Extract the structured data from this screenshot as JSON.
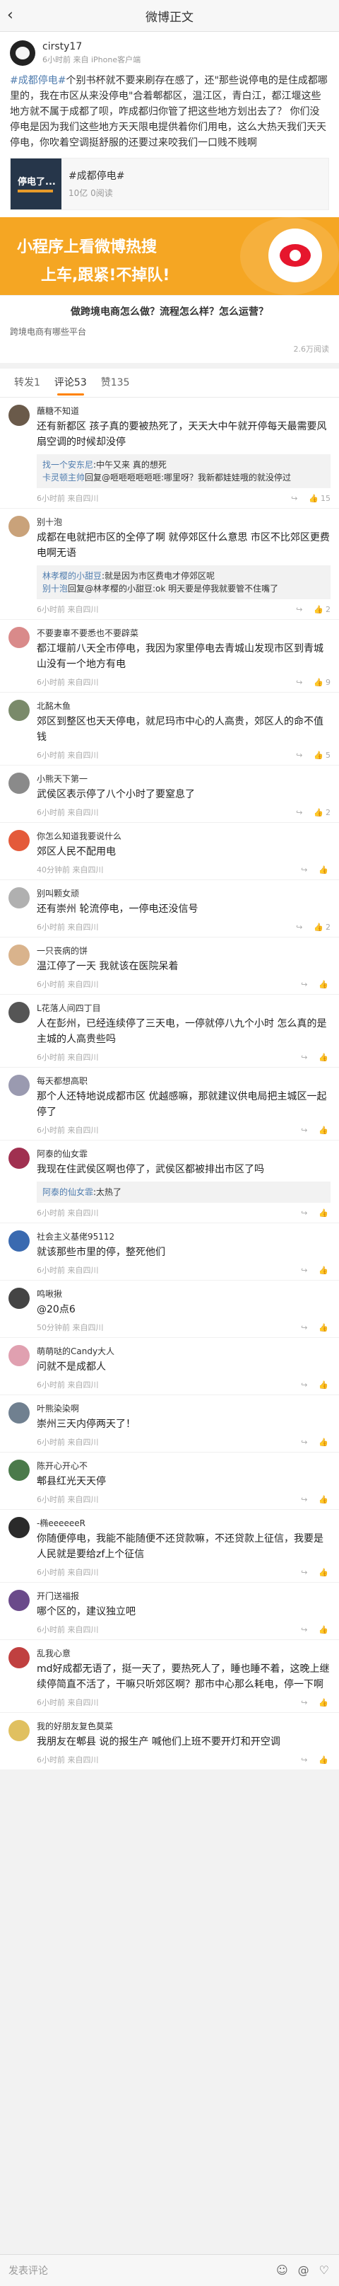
{
  "topbar": {
    "back_icon": "back-arrow",
    "title": "微博正文"
  },
  "post": {
    "author": "cirsty17",
    "meta": "6小时前 来自 iPhone客户端",
    "hashtag": "#成都停电#",
    "text": "个别书杯就不要来刷存在感了，还\"那些说停电的是住成都哪里的，我在市区从来没停电\"合着郫都区，温江区，青白江，都江堰这些地方就不属于成都了呗，咋成都归你管了把这些地方划出去了？ 你们没停电是因为我们这些地方天天限电提供着你们用电，这么大热天我们天天停电，你吹着空调挺舒服的还要过来咬我们一口贱不贱啊",
    "share": {
      "thumb_text": "停电了...",
      "title": "#成都停电#",
      "reads": "10亿 0阅读"
    }
  },
  "banner": {
    "line1": "小程序上看微博热搜",
    "line2": "上车,跟紧!不掉队!"
  },
  "ad": {
    "title": "做跨境电商怎么做？流程怎么样？怎么运营？",
    "sub": "跨境电商有哪些平台",
    "reads": "2.6万阅读"
  },
  "tabs": {
    "repost": "转发1",
    "comment": "评论53",
    "like": "赞135"
  },
  "comments": [
    {
      "name": "蘸糖不知道",
      "text": "还有新都区 孩子真的要被热死了，天天大中午就开停每天最需要风扇空调的时候却没停",
      "reply": [
        {
          "n": "找一个安东尼",
          "t": ":中午又来 真的想死"
        },
        {
          "n": "卡灵顿主帅",
          "t": "回复@咂咂咂咂咂咂:哪里呀？我新都娃娃哦的就没停过"
        }
      ],
      "time": "6小时前 来自四川",
      "likes": "15",
      "avatar": "#6a5a4a"
    },
    {
      "name": "别十泡",
      "text": "成都在电就把市区的全停了啊 就停郊区什么意思 市区不比郊区更费电啊无语",
      "reply": [
        {
          "n": "林孝樱的小甜豆",
          "t": ":就是因为市区费电才停郊区呢"
        },
        {
          "n": "别十泡",
          "t": "回复@林孝樱的小甜豆:ok 明天要是停我就要管不住嘴了"
        }
      ],
      "time": "6小时前 来自四川",
      "likes": "2",
      "avatar": "#c9a27a"
    },
    {
      "name": "不要妻辜不要悉也不要辟菜",
      "text": "都江堰前八天全市停电，我因为家里停电去青城山发现市区到青城山没有一个地方有电",
      "reply": [],
      "time": "6小时前 来自四川",
      "likes": "9",
      "avatar": "#d98a8a"
    },
    {
      "name": "北酩木鱼",
      "text": "郊区到整区也天天停电，就尼玛市中心的人高贵，郊区人的命不值钱",
      "reply": [],
      "time": "6小时前 来自四川",
      "likes": "5",
      "avatar": "#7a8a6a"
    },
    {
      "name": "小熊天下第一",
      "text": "武侯区表示停了八个小时了要窒息了",
      "reply": [],
      "time": "6小时前 来自四川",
      "likes": "2",
      "avatar": "#8a8a8a"
    },
    {
      "name": "你怎么知道我要说什么",
      "text": "郊区人民不配用电",
      "reply": [],
      "time": "40分钟前 来自四川",
      "likes": "",
      "avatar": "#e45a3a"
    },
    {
      "name": "别叫颗女顽",
      "text": "还有崇州 轮流停电，一停电还没信号",
      "reply": [],
      "time": "6小时前 来自四川",
      "likes": "2",
      "avatar": "#b0b0b0"
    },
    {
      "name": "一只丧病的饼",
      "text": "温江停了一天 我就该在医院呆着",
      "reply": [],
      "time": "6小时前 来自四川",
      "likes": "",
      "avatar": "#d9b38c"
    },
    {
      "name": "L花落人间四丁目",
      "text": "人在彭州，已经连续停了三天电，一停就停八九个小时 怎么真的是主城的人高贵些吗",
      "reply": [],
      "time": "6小时前 来自四川",
      "likes": "",
      "avatar": "#555555"
    },
    {
      "name": "每天都想高职",
      "text": "那个人还特地说成都市区 优越感嘛，那就建议供电局把主城区一起停了",
      "reply": [],
      "time": "6小时前 来自四川",
      "likes": "",
      "avatar": "#9a9ab0"
    },
    {
      "name": "阿泰的仙女霏",
      "text": "我现在住武侯区啊也停了，武侯区都被排出市区了吗",
      "reply": [
        {
          "n": "阿泰的仙女霏",
          "t": ":太热了"
        }
      ],
      "time": "6小时前 来自四川",
      "likes": "",
      "avatar": "#a03050"
    },
    {
      "name": "社会主义基佬95112",
      "text": "就该那些市里的停，整死他们",
      "reply": [],
      "time": "6小时前 来自四川",
      "likes": "",
      "avatar": "#3a6ab0"
    },
    {
      "name": "鸣啾揪",
      "text": "@20点6",
      "reply": [],
      "time": "50分钟前 来自四川",
      "likes": "",
      "avatar": "#444444"
    },
    {
      "name": "萌萌哒的Candy大人",
      "text": "问就不是成都人",
      "reply": [],
      "time": "6小时前 来自四川",
      "likes": "",
      "avatar": "#e0a0b0"
    },
    {
      "name": "叶熊染染啊",
      "text": "崇州三天内停两天了！",
      "reply": [],
      "time": "6小时前 来自四川",
      "likes": "",
      "avatar": "#708090"
    },
    {
      "name": "陈开心开心不",
      "text": "郫县红光天天停",
      "reply": [],
      "time": "6小时前 来自四川",
      "likes": "",
      "avatar": "#4a7a4a"
    },
    {
      "name": "-椭eeeeeeR",
      "text": "你随便停电，我能不能随便不还贷款嘛，不还贷款上征信，我要是人民就是要给zf上个征信",
      "reply": [],
      "time": "6小时前 来自四川",
      "likes": "",
      "avatar": "#2a2a2a"
    },
    {
      "name": "开门送福报",
      "text": "哪个区的，建议独立吧",
      "reply": [],
      "time": "6小时前 来自四川",
      "likes": "",
      "avatar": "#6a4a8a"
    },
    {
      "name": "乱我心意",
      "text": "md好成都无语了，挺一天了，要热死人了，睡也睡不着，这晚上继续停简直不活了，干嘛只听郊区啊？那市中心那么耗电，停一下啊",
      "reply": [],
      "time": "6小时前 来自四川",
      "likes": "",
      "avatar": "#c04040"
    },
    {
      "name": "我的好朋友复色莫菜",
      "text": "我朋友在郫县 说的报生产 喊他们上班不要开灯和开空调",
      "reply": [],
      "time": "6小时前 来自四川",
      "likes": "",
      "avatar": "#e0c060"
    }
  ],
  "bottombar": {
    "placeholder": "发表评论",
    "icons": [
      "smile-icon",
      "at-icon",
      "like-icon"
    ]
  }
}
